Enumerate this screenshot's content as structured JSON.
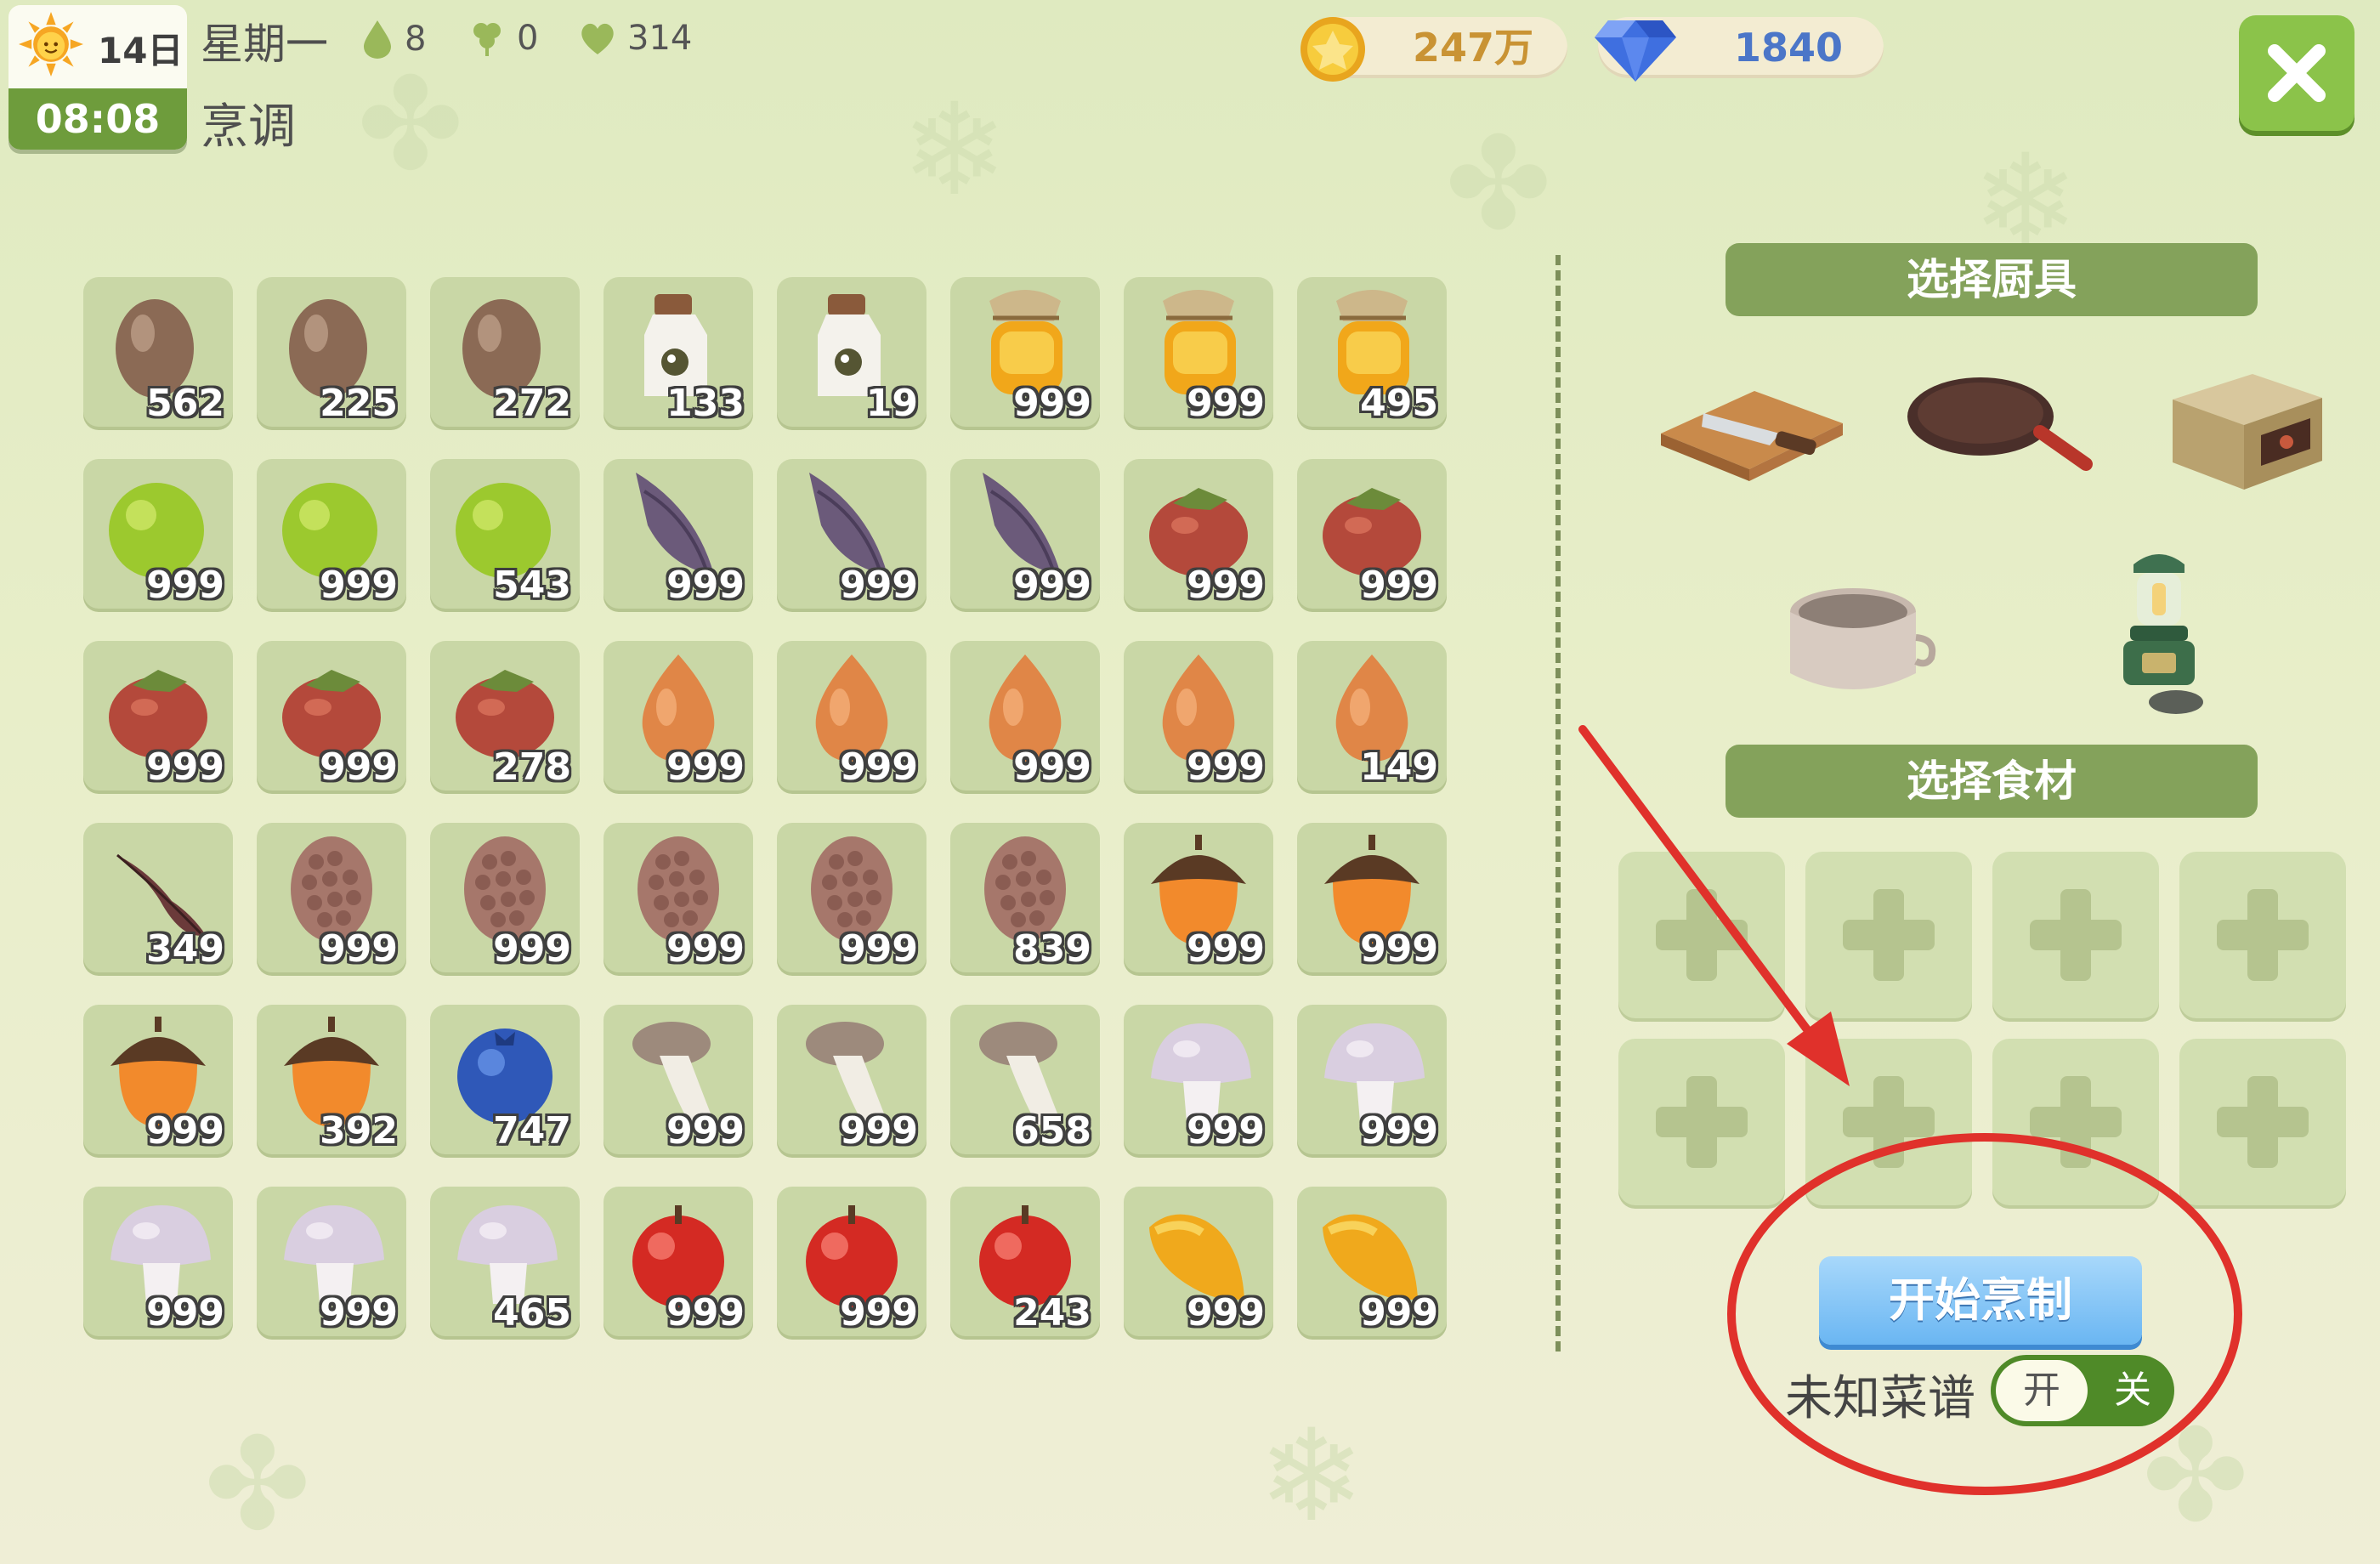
{
  "header": {
    "day": "14日",
    "time": "08:08",
    "weekday": "星期一",
    "activity": "烹调",
    "stats": {
      "stamina": "8",
      "clover": "0",
      "hearts": "314"
    },
    "coins": "247万",
    "gems": "1840"
  },
  "inventory": {
    "items": [
      {
        "icon": "egg-icon",
        "count": "562"
      },
      {
        "icon": "egg-icon",
        "count": "225"
      },
      {
        "icon": "egg-icon",
        "count": "272"
      },
      {
        "icon": "milk-bottle-icon",
        "count": "133"
      },
      {
        "icon": "milk-bottle-icon",
        "count": "19"
      },
      {
        "icon": "honey-jar-icon",
        "count": "999"
      },
      {
        "icon": "honey-jar-icon",
        "count": "999"
      },
      {
        "icon": "honey-jar-icon",
        "count": "495"
      },
      {
        "icon": "green-fruit-icon",
        "count": "999"
      },
      {
        "icon": "green-fruit-icon",
        "count": "999"
      },
      {
        "icon": "green-fruit-icon",
        "count": "543"
      },
      {
        "icon": "bamboo-shoot-icon",
        "count": "999"
      },
      {
        "icon": "bamboo-shoot-icon",
        "count": "999"
      },
      {
        "icon": "bamboo-shoot-icon",
        "count": "999"
      },
      {
        "icon": "persimmon-icon",
        "count": "999"
      },
      {
        "icon": "persimmon-icon",
        "count": "999"
      },
      {
        "icon": "persimmon-icon",
        "count": "999"
      },
      {
        "icon": "persimmon-icon",
        "count": "999"
      },
      {
        "icon": "persimmon-icon",
        "count": "278"
      },
      {
        "icon": "onion-icon",
        "count": "999"
      },
      {
        "icon": "onion-icon",
        "count": "999"
      },
      {
        "icon": "onion-icon",
        "count": "999"
      },
      {
        "icon": "onion-icon",
        "count": "999"
      },
      {
        "icon": "onion-icon",
        "count": "149"
      },
      {
        "icon": "leaf-icon",
        "count": "349"
      },
      {
        "icon": "pinecone-icon",
        "count": "999"
      },
      {
        "icon": "pinecone-icon",
        "count": "999"
      },
      {
        "icon": "pinecone-icon",
        "count": "999"
      },
      {
        "icon": "pinecone-icon",
        "count": "999"
      },
      {
        "icon": "pinecone-icon",
        "count": "839"
      },
      {
        "icon": "acorn-icon",
        "count": "999"
      },
      {
        "icon": "acorn-icon",
        "count": "999"
      },
      {
        "icon": "acorn-icon",
        "count": "999"
      },
      {
        "icon": "acorn-icon",
        "count": "392"
      },
      {
        "icon": "blueberry-icon",
        "count": "747"
      },
      {
        "icon": "king-oyster-mushroom-icon",
        "count": "999"
      },
      {
        "icon": "king-oyster-mushroom-icon",
        "count": "999"
      },
      {
        "icon": "king-oyster-mushroom-icon",
        "count": "658"
      },
      {
        "icon": "white-mushroom-icon",
        "count": "999"
      },
      {
        "icon": "white-mushroom-icon",
        "count": "999"
      },
      {
        "icon": "white-mushroom-icon",
        "count": "999"
      },
      {
        "icon": "white-mushroom-icon",
        "count": "999"
      },
      {
        "icon": "white-mushroom-icon",
        "count": "465"
      },
      {
        "icon": "apple-icon",
        "count": "999"
      },
      {
        "icon": "apple-icon",
        "count": "999"
      },
      {
        "icon": "apple-icon",
        "count": "243"
      },
      {
        "icon": "mango-icon",
        "count": "999"
      },
      {
        "icon": "mango-icon",
        "count": "999"
      }
    ]
  },
  "cookware": {
    "title": "选择厨具",
    "tools": [
      "cutting-board-icon",
      "frying-pan-icon",
      "oven-icon",
      "pot-icon",
      "camping-stove-icon"
    ]
  },
  "ingredients": {
    "title": "选择食材",
    "slot_count": 8
  },
  "start_button": "开始烹制",
  "unknown_recipe": {
    "label": "未知菜谱",
    "on": "开",
    "off": "关",
    "state": "off"
  },
  "colors": {
    "accent": "#84a25b",
    "button": "#6ab6f2",
    "annotation": "#e0312b"
  }
}
